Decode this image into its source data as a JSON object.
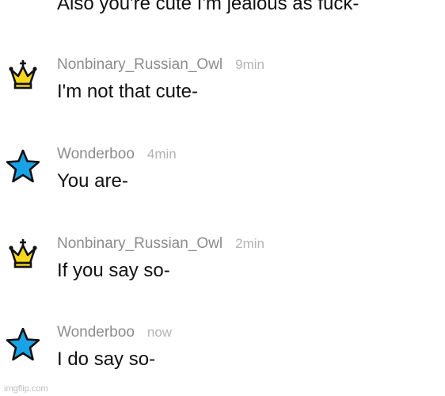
{
  "chat": {
    "previous_message_text": "Also you're cute I'm jealous as fuck-",
    "messages": [
      {
        "avatar_icon": "crown-icon",
        "username": "Nonbinary_Russian_Owl",
        "time": "9min",
        "text": "I'm not that cute-"
      },
      {
        "avatar_icon": "star-icon",
        "username": "Wonderboo",
        "time": "4min",
        "text": "You are-"
      },
      {
        "avatar_icon": "crown-icon",
        "username": "Nonbinary_Russian_Owl",
        "time": "2min",
        "text": "If you say so-"
      },
      {
        "avatar_icon": "star-icon",
        "username": "Wonderboo",
        "time": "now",
        "text": "I do say so-"
      }
    ]
  },
  "watermark": "imgflip.com",
  "colors": {
    "crown_fill": "#f7d71b",
    "star_fill": "#1aa2e6",
    "username": "#8c8c8c",
    "timestamp": "#b4b4b4",
    "message_text": "#111111"
  }
}
